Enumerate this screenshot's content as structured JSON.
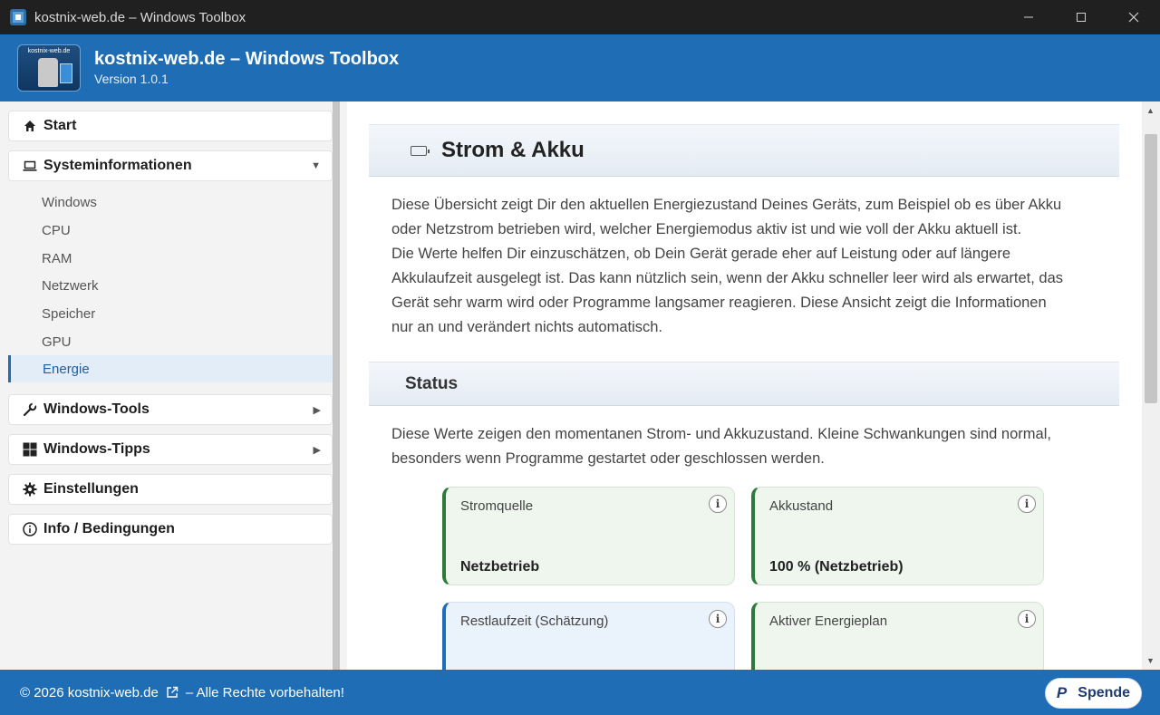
{
  "window": {
    "title": "kostnix-web.de – Windows Toolbox",
    "icon": "app-icon"
  },
  "header": {
    "logo_text": "kostnix-web.de",
    "title": "kostnix-web.de – Windows Toolbox",
    "version": "Version 1.0.1"
  },
  "sidebar": {
    "start": "Start",
    "sysinfo": "Systeminformationen",
    "sysinfo_items": [
      "Windows",
      "CPU",
      "RAM",
      "Netzwerk",
      "Speicher",
      "GPU",
      "Energie"
    ],
    "active_item": "Energie",
    "tools": "Windows-Tools",
    "tips": "Windows-Tipps",
    "settings": "Einstellungen",
    "info": "Info / Bedingungen"
  },
  "main": {
    "title": "Strom & Akku",
    "intro_lines": [
      "Diese Übersicht zeigt Dir den aktuellen Energiezustand Deines Geräts, zum Beispiel ob es über Akku",
      "oder Netzstrom betrieben wird, welcher Energiemodus aktiv ist und wie voll der Akku aktuell ist.",
      "Die Werte helfen Dir einzuschätzen, ob Dein Gerät gerade eher auf Leistung oder auf längere",
      "Akkulaufzeit ausgelegt ist. Das kann nützlich sein, wenn der Akku schneller leer wird als erwartet, das",
      "Gerät sehr warm wird oder Programme langsamer reagieren. Diese Ansicht zeigt die Informationen",
      "nur an und verändert nichts automatisch."
    ],
    "status_title": "Status",
    "status_lines": [
      "Diese Werte zeigen den momentanen Strom- und Akkuzustand. Kleine Schwankungen sind normal,",
      "besonders wenn Programme gestartet oder geschlossen werden."
    ],
    "cards": [
      {
        "title": "Stromquelle",
        "value": "Netzbetrieb",
        "info": "i",
        "color": "#2d7a3a"
      },
      {
        "title": "Akkustand",
        "value": "100 % (Netzbetrieb)",
        "info": "i",
        "color": "#2d7a3a"
      },
      {
        "title": "Restlaufzeit (Schätzung)",
        "value": "",
        "info": "i",
        "color": "#1f6db5"
      },
      {
        "title": "Aktiver Energieplan",
        "value": "",
        "info": "i",
        "color": "#2d7a3a"
      }
    ]
  },
  "footer": {
    "copyright": "© 2026 kostnix-web.de",
    "rights": "– Alle Rechte vorbehalten!",
    "donate": "Spende",
    "donate_icon": "paypal-icon"
  },
  "colors": {
    "accent": "#1f6db5",
    "titlebar": "#202020",
    "card_green": "#2d7a3a"
  }
}
